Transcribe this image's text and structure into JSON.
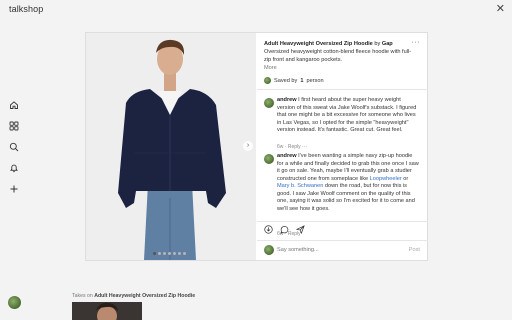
{
  "app": {
    "name": "talkshop"
  },
  "nav": {
    "items": [
      {
        "name": "home-icon"
      },
      {
        "name": "grid-icon"
      },
      {
        "name": "search-icon"
      },
      {
        "name": "bell-icon"
      },
      {
        "name": "plus-icon"
      }
    ]
  },
  "product": {
    "title": "Adult Heavyweight Oversized Zip Hoodie",
    "by_label": "by",
    "brand": "Gap",
    "description": "Oversized heavyweight cotton-blend fleece hoodie with full-zip front and kangaroo pockets.",
    "more_label": "More",
    "saved_prefix": "Saved by",
    "saved_count": "1",
    "saved_suffix": "person",
    "photo_count": 7,
    "photo_active": 0
  },
  "comments": [
    {
      "user": "andrew",
      "text": "I first heard about the super heavy weight version of this sweat via Jake Woolf's substack. I figured that one might be a bit excessive for someone who lives in Las Vegas, so I opted for the simple \"heavyweight\" version instead. It's fantastic. Great cut. Great feel.",
      "time": "6w",
      "reply_label": "Reply",
      "more_label": "···"
    },
    {
      "user": "andrew",
      "text_a": "I've been wanting a simple navy zip-up hoodie for a while and finally decided to grab this one once I saw it go on sale. Yeah, maybe I'll eventually grab a studier constructed one from someplace like",
      "link1": "Loopwheeler",
      "text_b": "or",
      "link2": "Mary b. Schwanen",
      "text_c": "down the road, but for now this is good. I saw Jake Woolf comment on the quality of this one, saying it was solid so I'm excited for it to come and we'll see how it goes.",
      "time": "6w",
      "reply_label": "Reply"
    }
  ],
  "compose": {
    "placeholder": "Say something...",
    "post_label": "Post"
  },
  "takes": {
    "prefix": "Takes on",
    "title": "Adult Heavyweight Oversized Zip Hoodie"
  },
  "colors": {
    "accent_link": "#2f6ec8",
    "hoodie": "#1c2340",
    "jeans": "#5f7fa3"
  }
}
